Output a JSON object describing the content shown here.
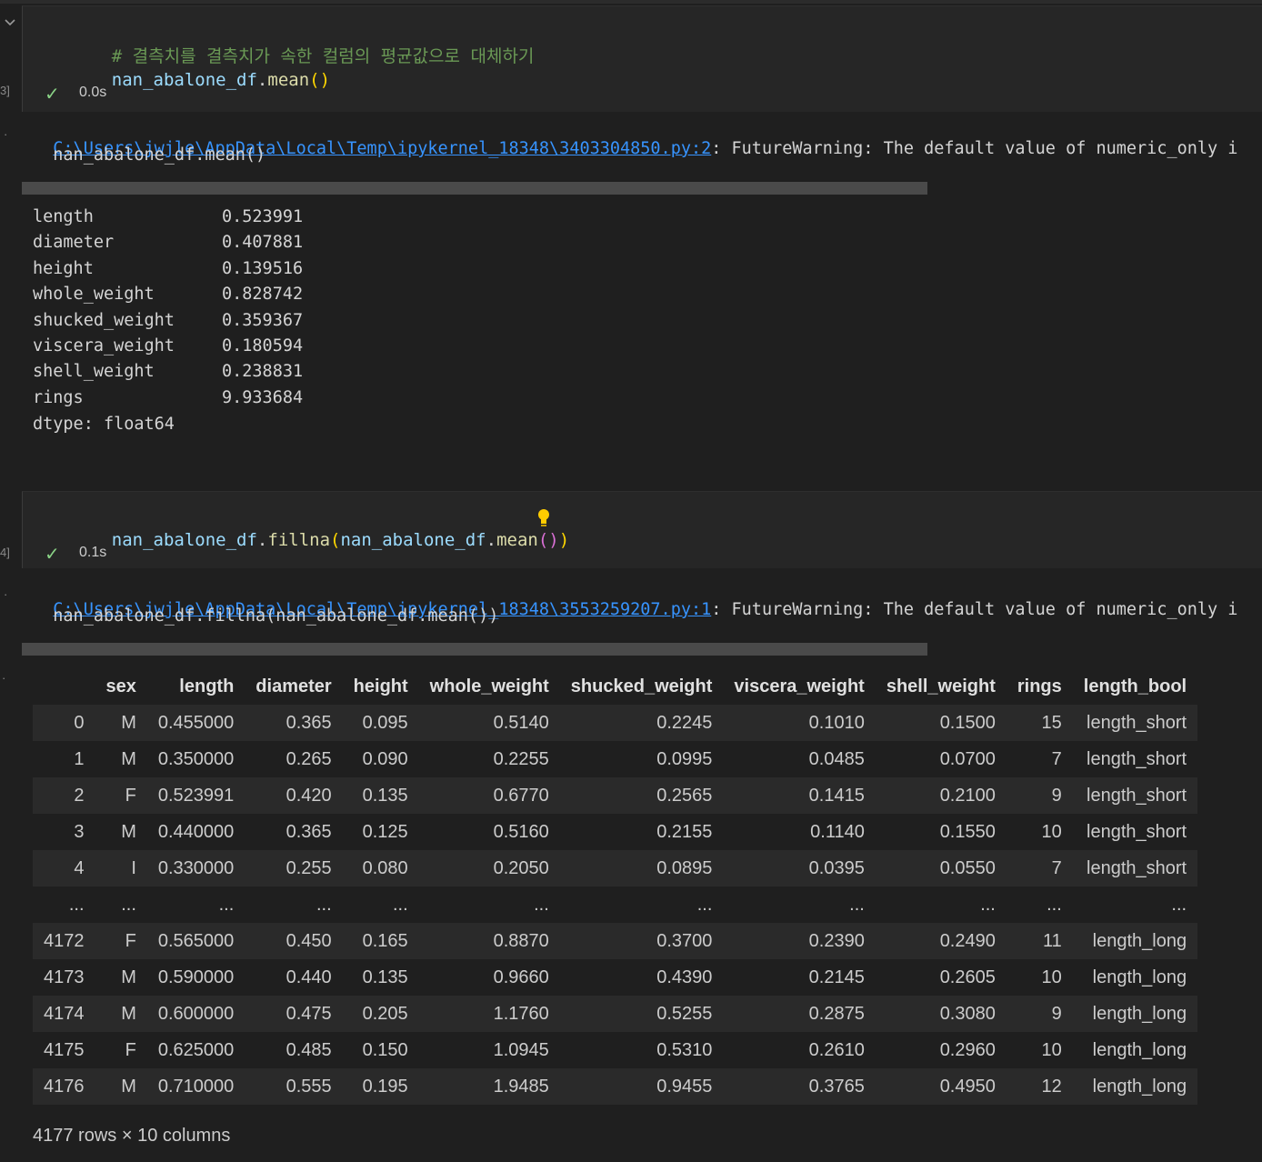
{
  "cell1": {
    "exec_count": "3]",
    "comment": "# 결측치를 결측치가 속한 컬럼의 평균값으로 대체하기",
    "code_var": "nan_abalone_df",
    "code_method": "mean",
    "code_parens": "()",
    "status_time": "0.0s",
    "warning_link": "C:\\Users\\jwjle\\AppData\\Local\\Temp\\ipykernel_18348\\3403304850.py:2",
    "warning_text": ": FutureWarning: The default value of numeric_only i",
    "warning_code": "  nan_abalone_df.mean()",
    "series": [
      {
        "name": "length",
        "value": "0.523991"
      },
      {
        "name": "diameter",
        "value": "0.407881"
      },
      {
        "name": "height",
        "value": "0.139516"
      },
      {
        "name": "whole_weight",
        "value": "0.828742"
      },
      {
        "name": "shucked_weight",
        "value": "0.359367"
      },
      {
        "name": "viscera_weight",
        "value": "0.180594"
      },
      {
        "name": "shell_weight",
        "value": "0.238831"
      },
      {
        "name": "rings",
        "value": "9.933684"
      }
    ],
    "dtype": "dtype: float64"
  },
  "cell2": {
    "exec_count": "4]",
    "code_var1": "nan_abalone_df",
    "code_method1": "fillna",
    "code_var2": "nan_abalone_df",
    "code_method2": "mean",
    "status_time": "0.1s",
    "warning_link": "C:\\Users\\jwjle\\AppData\\Local\\Temp\\ipykernel_18348\\3553259207.py:1",
    "warning_text": ": FutureWarning: The default value of numeric_only i",
    "warning_code": "  nan_abalone_df.fillna(nan_abalone_df.mean())",
    "table": {
      "columns": [
        "",
        "sex",
        "length",
        "diameter",
        "height",
        "whole_weight",
        "shucked_weight",
        "viscera_weight",
        "shell_weight",
        "rings",
        "length_bool"
      ],
      "rows": [
        [
          "0",
          "M",
          "0.455000",
          "0.365",
          "0.095",
          "0.5140",
          "0.2245",
          "0.1010",
          "0.1500",
          "15",
          "length_short"
        ],
        [
          "1",
          "M",
          "0.350000",
          "0.265",
          "0.090",
          "0.2255",
          "0.0995",
          "0.0485",
          "0.0700",
          "7",
          "length_short"
        ],
        [
          "2",
          "F",
          "0.523991",
          "0.420",
          "0.135",
          "0.6770",
          "0.2565",
          "0.1415",
          "0.2100",
          "9",
          "length_short"
        ],
        [
          "3",
          "M",
          "0.440000",
          "0.365",
          "0.125",
          "0.5160",
          "0.2155",
          "0.1140",
          "0.1550",
          "10",
          "length_short"
        ],
        [
          "4",
          "I",
          "0.330000",
          "0.255",
          "0.080",
          "0.2050",
          "0.0895",
          "0.0395",
          "0.0550",
          "7",
          "length_short"
        ],
        [
          "...",
          "...",
          "...",
          "...",
          "...",
          "...",
          "...",
          "...",
          "...",
          "...",
          "..."
        ],
        [
          "4172",
          "F",
          "0.565000",
          "0.450",
          "0.165",
          "0.8870",
          "0.3700",
          "0.2390",
          "0.2490",
          "11",
          "length_long"
        ],
        [
          "4173",
          "M",
          "0.590000",
          "0.440",
          "0.135",
          "0.9660",
          "0.4390",
          "0.2145",
          "0.2605",
          "10",
          "length_long"
        ],
        [
          "4174",
          "M",
          "0.600000",
          "0.475",
          "0.205",
          "1.1760",
          "0.5255",
          "0.2875",
          "0.3080",
          "9",
          "length_long"
        ],
        [
          "4175",
          "F",
          "0.625000",
          "0.485",
          "0.150",
          "1.0945",
          "0.5310",
          "0.2610",
          "0.2960",
          "10",
          "length_long"
        ],
        [
          "4176",
          "M",
          "0.710000",
          "0.555",
          "0.195",
          "1.9485",
          "0.9455",
          "0.3765",
          "0.4950",
          "12",
          "length_long"
        ]
      ],
      "shape": "4177 rows × 10 columns"
    }
  }
}
